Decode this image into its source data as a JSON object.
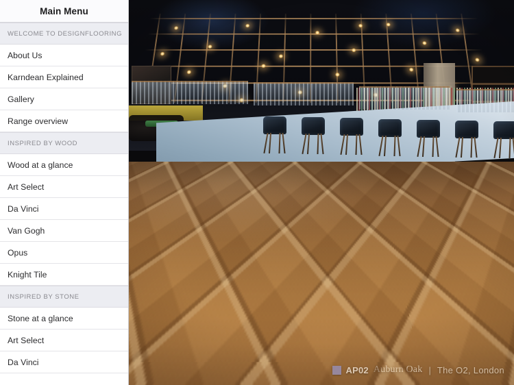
{
  "sidebar": {
    "header_title": "Main Menu",
    "sections": [
      {
        "label": "WELCOME TO DESIGNFLOORING",
        "items": [
          {
            "label": "About Us"
          },
          {
            "label": "Karndean Explained"
          },
          {
            "label": "Gallery"
          },
          {
            "label": "Range overview"
          }
        ]
      },
      {
        "label": "INSPIRED BY WOOD",
        "items": [
          {
            "label": "Wood at a glance"
          },
          {
            "label": "Art Select"
          },
          {
            "label": "Da Vinci"
          },
          {
            "label": "Van Gogh"
          },
          {
            "label": "Opus"
          },
          {
            "label": "Knight Tile"
          }
        ]
      },
      {
        "label": "INSPIRED BY STONE",
        "items": [
          {
            "label": "Stone at a glance"
          },
          {
            "label": "Art Select"
          },
          {
            "label": "Da Vinci"
          }
        ]
      }
    ]
  },
  "hero": {
    "caption": {
      "swatch_color": "#8b93dd",
      "product_code": "AP02",
      "product_name": "Auburn Oak",
      "separator": "|",
      "location": "The O2, London"
    }
  }
}
